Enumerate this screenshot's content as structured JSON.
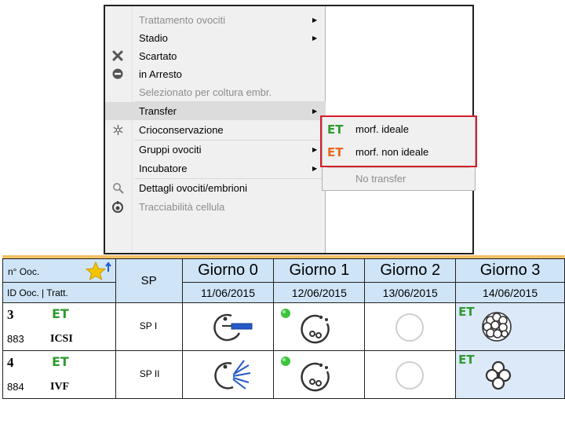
{
  "context_menu": {
    "items": [
      {
        "label": "Trattamento ovociti",
        "disabled": true,
        "submenu": true
      },
      {
        "label": "Stadio",
        "disabled": false,
        "submenu": true
      },
      {
        "label": "Scartato",
        "disabled": false,
        "icon": "x-icon"
      },
      {
        "label": "in Arresto",
        "disabled": false,
        "icon": "stop-icon"
      },
      {
        "label": "Selezionato per coltura embr.",
        "disabled": true
      },
      {
        "label": "Transfer",
        "disabled": false,
        "submenu": true,
        "highlighted": true
      },
      {
        "label": "Crioconservazione",
        "disabled": false,
        "icon": "snowflake-icon"
      },
      {
        "label": "Gruppi ovociti",
        "disabled": false,
        "submenu": true
      },
      {
        "label": "Incubatore",
        "disabled": false,
        "submenu": true
      },
      {
        "label": "Dettagli ovociti/embrioni",
        "disabled": false,
        "icon": "magnifier-icon"
      },
      {
        "label": "Tracciabilità cellula",
        "disabled": true,
        "icon": "trace-icon"
      }
    ]
  },
  "transfer_submenu": {
    "items": [
      {
        "badge": "ET",
        "label": "morf. ideale",
        "badge_color": "#2f9a2f"
      },
      {
        "badge": "ET",
        "label": "morf. non ideale",
        "badge_color": "#e86a1e"
      },
      {
        "label": "No transfer",
        "disabled": true
      }
    ]
  },
  "grid": {
    "header": {
      "noc_label": "n° Ooc.",
      "id_label": "ID Ooc. | Tratt.",
      "sp_label": "SP",
      "days": [
        "Giorno 0",
        "Giorno 1",
        "Giorno 2",
        "Giorno 3"
      ],
      "dates": [
        "11/06/2015",
        "12/06/2015",
        "13/06/2015",
        "14/06/2015"
      ]
    },
    "rows": [
      {
        "num": "3",
        "et": "ET",
        "id": "883",
        "treatment": "ICSI",
        "sp": "SP I",
        "day3_et": "ET"
      },
      {
        "num": "4",
        "et": "ET",
        "id": "884",
        "treatment": "IVF",
        "sp": "SP II",
        "day3_et": "ET"
      }
    ],
    "colors": {
      "header_bg": "#cfe4f7",
      "et_green": "#2f9a2f",
      "et_orange": "#e86a1e",
      "star": "#f5c400"
    }
  }
}
